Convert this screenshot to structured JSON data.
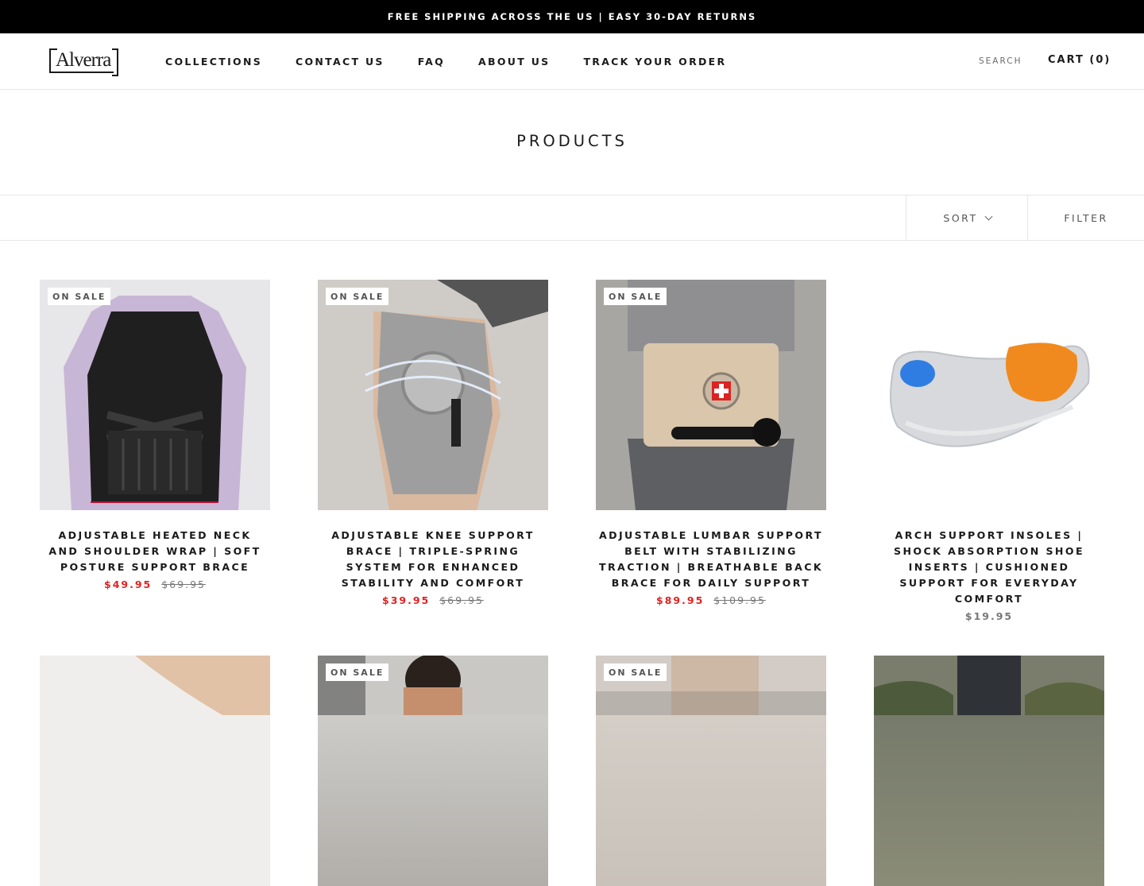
{
  "announcement": "FREE SHIPPING ACROSS THE US | EASY 30-DAY RETURNS",
  "brand": {
    "logo_text": "Alverra"
  },
  "nav": [
    {
      "label": "COLLECTIONS"
    },
    {
      "label": "CONTACT US"
    },
    {
      "label": "FAQ"
    },
    {
      "label": "ABOUT US"
    },
    {
      "label": "TRACK YOUR ORDER"
    }
  ],
  "header": {
    "search_label": "SEARCH",
    "cart_label": "CART (0)"
  },
  "page": {
    "title": "PRODUCTS"
  },
  "toolbar": {
    "sort_label": "SORT",
    "filter_label": "FILTER"
  },
  "colors": {
    "sale_price": "#e22120",
    "announcement_bg": "#000000"
  },
  "products": [
    {
      "badge": "ON SALE",
      "title": "ADJUSTABLE HEATED NECK AND SHOULDER WRAP | SOFT POSTURE SUPPORT BRACE",
      "sale_price": "$49.95",
      "compare_price": "$69.95"
    },
    {
      "badge": "ON SALE",
      "title": "ADJUSTABLE KNEE SUPPORT BRACE | TRIPLE-SPRING SYSTEM FOR ENHANCED STABILITY AND COMFORT",
      "sale_price": "$39.95",
      "compare_price": "$69.95"
    },
    {
      "badge": "ON SALE",
      "title": "ADJUSTABLE LUMBAR SUPPORT BELT WITH STABILIZING TRACTION | BREATHABLE BACK BRACE FOR DAILY SUPPORT",
      "sale_price": "$89.95",
      "compare_price": "$109.95"
    },
    {
      "badge": "",
      "title": "ARCH SUPPORT INSOLES | SHOCK ABSORPTION SHOE INSERTS | CUSHIONED SUPPORT FOR EVERYDAY COMFORT",
      "price": "$19.95"
    },
    {
      "badge": ""
    },
    {
      "badge": "ON SALE"
    },
    {
      "badge": "ON SALE"
    },
    {
      "badge": ""
    }
  ]
}
